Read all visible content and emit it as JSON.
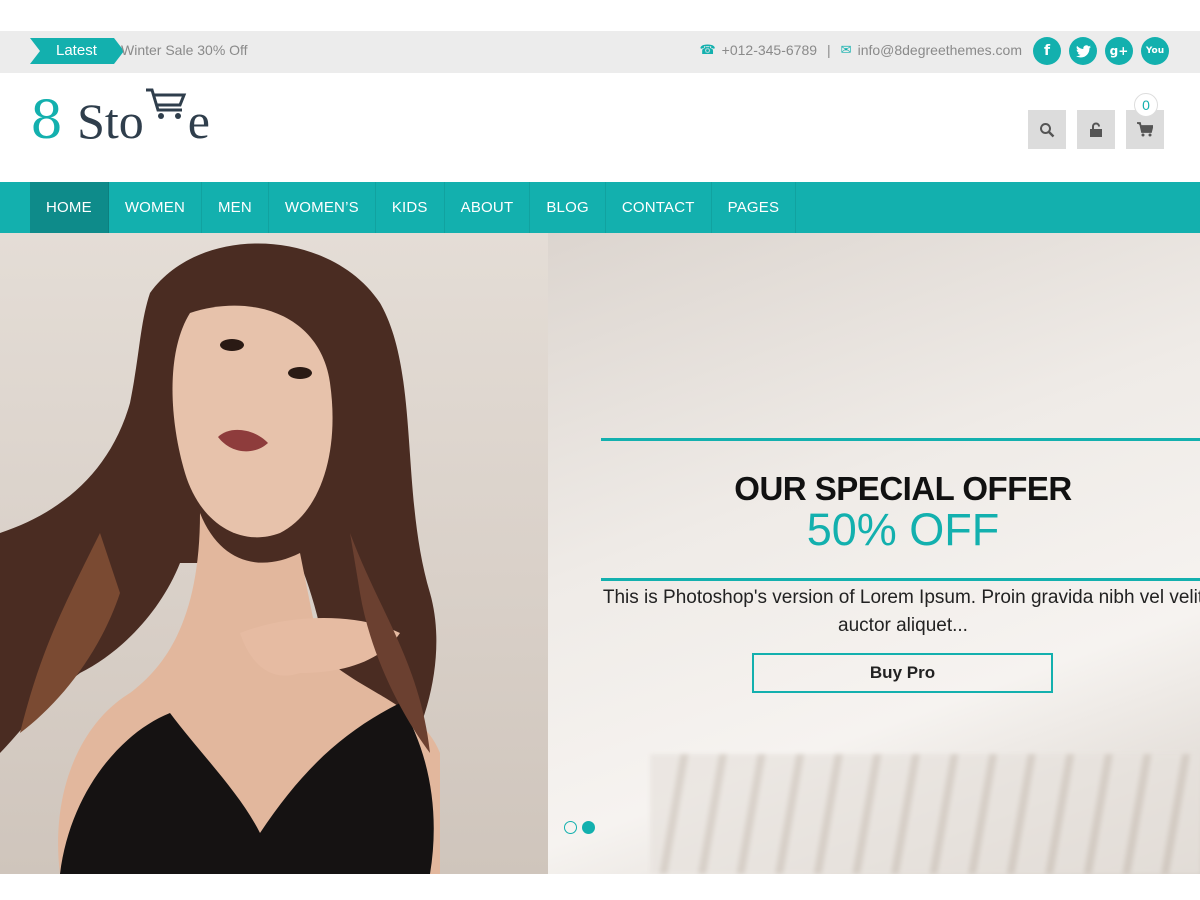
{
  "topbar": {
    "latest_label": "Latest",
    "ticker_text": "Winter Sale 30% Off",
    "phone": "+012-345-6789",
    "separator": "|",
    "email": "info@8degreethemes.com",
    "socials": [
      "facebook-icon",
      "twitter-icon",
      "google-plus-icon",
      "youtube-icon"
    ]
  },
  "header": {
    "logo_number": "8",
    "logo_text_a": "Sto",
    "logo_text_b": "e",
    "cart_count": "0"
  },
  "nav": {
    "items": [
      "HOME",
      "WOMEN",
      "MEN",
      "WOMEN’S",
      "KIDS",
      "ABOUT",
      "BLOG",
      "CONTACT",
      "PAGES"
    ],
    "active_index": 0
  },
  "hero": {
    "title": "OUR SPECIAL OFFER",
    "subtitle": "50% OFF",
    "desc_line1": "This is Photoshop's version of Lorem Ipsum. Proin gravida nibh vel velit",
    "desc_line2": "auctor aliquet...",
    "button_label": "Buy Pro",
    "slides": 2,
    "active_slide": 1
  },
  "colors": {
    "accent": "#13b0ae",
    "nav_active": "#0e8b8a"
  }
}
